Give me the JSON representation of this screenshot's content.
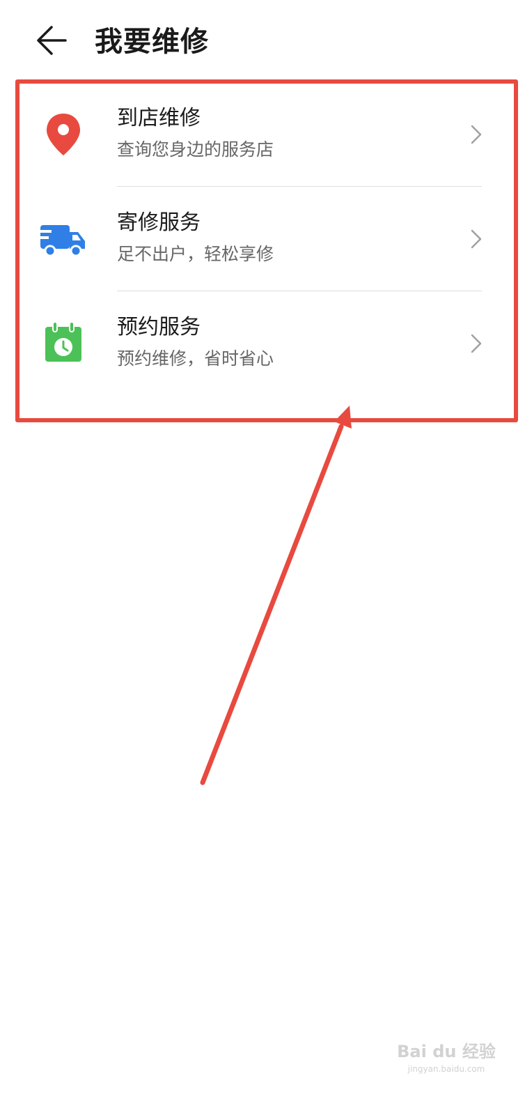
{
  "header": {
    "title": "我要维修",
    "back_icon": "arrow-left-icon"
  },
  "items": [
    {
      "title": "到店维修",
      "subtitle": "查询您身边的服务店",
      "icon": "location-pin-icon",
      "icon_color": "#e84a3f"
    },
    {
      "title": "寄修服务",
      "subtitle": "足不出户，轻松享修",
      "icon": "delivery-truck-icon",
      "icon_color": "#2f7fe6"
    },
    {
      "title": "预约服务",
      "subtitle": "预约维修，省时省心",
      "icon": "calendar-clock-icon",
      "icon_color": "#4cc157"
    }
  ],
  "annotation": {
    "color": "#e84a3f"
  },
  "watermark": {
    "main": "Bai du 经验",
    "url": "jingyan.baidu.com"
  }
}
